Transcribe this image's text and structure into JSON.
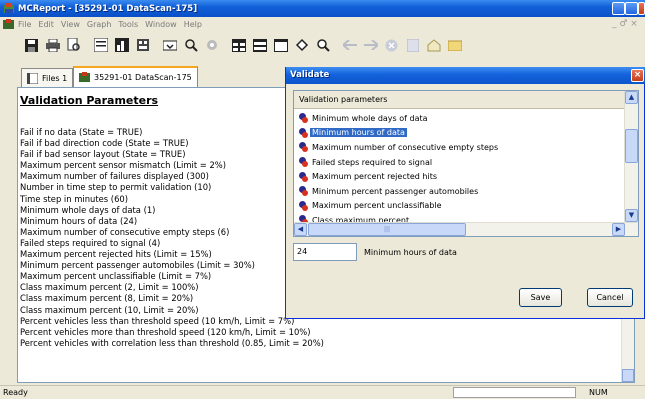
{
  "window": {
    "title": "MCReport - [35291-01 DataScan-175]",
    "menu": [
      "File",
      "Edit",
      "View",
      "Graph",
      "Tools",
      "Window",
      "Help"
    ],
    "mdi_controls": "_ ♂ ×"
  },
  "toolbar": {
    "icons": [
      "save-icon",
      "print-icon",
      "print-preview-icon",
      "open-report-icon",
      "graph-icon",
      "data-icon",
      "import-icon",
      "search-icon",
      "settings-icon",
      "table-icon",
      "columns-icon",
      "panel-icon",
      "drag-icon",
      "zoom-icon",
      "back-icon",
      "forward-icon",
      "stop-icon",
      "document-icon",
      "home-icon",
      "folder-icon"
    ]
  },
  "tabs": [
    {
      "label": "Files 1",
      "active": false
    },
    {
      "label": "35291-01 DataScan-175",
      "active": true
    }
  ],
  "document": {
    "heading": "Validation Parameters",
    "lines": [
      "Fail if no data (State = TRUE)",
      "Fail if bad direction code (State = TRUE)",
      "Fail if bad sensor layout (State = TRUE)",
      "Maximum percent sensor mismatch (Limit = 2%)",
      "Maximum number of failures displayed (300)",
      "Number in time step to permit validation (10)",
      "Time step in minutes (60)",
      "Minimum whole days of data (1)",
      "Minimum hours of data (24)",
      "Maximum number of consecutive empty steps (6)",
      "Failed steps required to signal (4)",
      "Maximum percent rejected hits (Limit = 15%)",
      "Minimum percent passenger automobiles (Limit = 30%)",
      "Maximum percent unclassifiable (Limit = 7%)",
      "Class maximum percent (2, Limit = 100%)",
      "Class maximum percent (8, Limit = 20%)",
      "Class maximum percent (10, Limit = 20%)",
      "Percent vehicles less than threshold speed (10 km/h, Limit = 7%)",
      "Percent vehicles more than threshold speed (120 km/h, Limit = 10%)",
      "Percent vehicles with correlation less than threshold (0.85, Limit = 20%)"
    ]
  },
  "status": {
    "ready": "Ready",
    "num": "NUM"
  },
  "dialog": {
    "title": "Validate",
    "close": "×",
    "list_header": "Validation parameters",
    "items": [
      "Minimum whole days of data",
      "Minimum hours of data",
      "Maximum number of consecutive empty steps",
      "Failed steps required to signal",
      "Maximum percent rejected hits",
      "Minimum percent passenger automobiles",
      "Maximum percent unclassifiable",
      "Class maximum percent"
    ],
    "selected_item": "Minimum hours of data",
    "value": "24",
    "value_label": "Minimum hours of data",
    "save_label": "Save",
    "cancel_label": "Cancel",
    "selection_color": "#316ac5"
  }
}
